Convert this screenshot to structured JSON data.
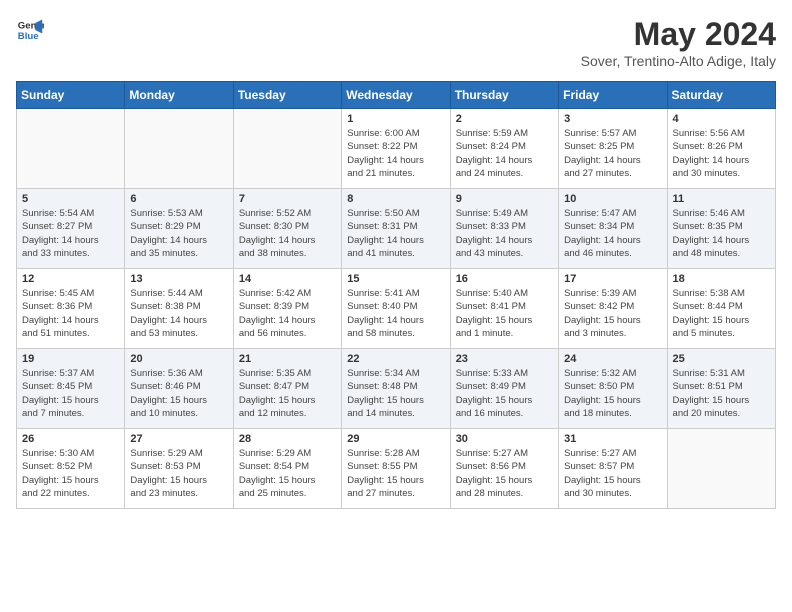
{
  "header": {
    "logo_line1": "General",
    "logo_line2": "Blue",
    "month": "May 2024",
    "location": "Sover, Trentino-Alto Adige, Italy"
  },
  "days_of_week": [
    "Sunday",
    "Monday",
    "Tuesday",
    "Wednesday",
    "Thursday",
    "Friday",
    "Saturday"
  ],
  "weeks": [
    [
      {
        "day": "",
        "info": ""
      },
      {
        "day": "",
        "info": ""
      },
      {
        "day": "",
        "info": ""
      },
      {
        "day": "1",
        "info": "Sunrise: 6:00 AM\nSunset: 8:22 PM\nDaylight: 14 hours\nand 21 minutes."
      },
      {
        "day": "2",
        "info": "Sunrise: 5:59 AM\nSunset: 8:24 PM\nDaylight: 14 hours\nand 24 minutes."
      },
      {
        "day": "3",
        "info": "Sunrise: 5:57 AM\nSunset: 8:25 PM\nDaylight: 14 hours\nand 27 minutes."
      },
      {
        "day": "4",
        "info": "Sunrise: 5:56 AM\nSunset: 8:26 PM\nDaylight: 14 hours\nand 30 minutes."
      }
    ],
    [
      {
        "day": "5",
        "info": "Sunrise: 5:54 AM\nSunset: 8:27 PM\nDaylight: 14 hours\nand 33 minutes."
      },
      {
        "day": "6",
        "info": "Sunrise: 5:53 AM\nSunset: 8:29 PM\nDaylight: 14 hours\nand 35 minutes."
      },
      {
        "day": "7",
        "info": "Sunrise: 5:52 AM\nSunset: 8:30 PM\nDaylight: 14 hours\nand 38 minutes."
      },
      {
        "day": "8",
        "info": "Sunrise: 5:50 AM\nSunset: 8:31 PM\nDaylight: 14 hours\nand 41 minutes."
      },
      {
        "day": "9",
        "info": "Sunrise: 5:49 AM\nSunset: 8:33 PM\nDaylight: 14 hours\nand 43 minutes."
      },
      {
        "day": "10",
        "info": "Sunrise: 5:47 AM\nSunset: 8:34 PM\nDaylight: 14 hours\nand 46 minutes."
      },
      {
        "day": "11",
        "info": "Sunrise: 5:46 AM\nSunset: 8:35 PM\nDaylight: 14 hours\nand 48 minutes."
      }
    ],
    [
      {
        "day": "12",
        "info": "Sunrise: 5:45 AM\nSunset: 8:36 PM\nDaylight: 14 hours\nand 51 minutes."
      },
      {
        "day": "13",
        "info": "Sunrise: 5:44 AM\nSunset: 8:38 PM\nDaylight: 14 hours\nand 53 minutes."
      },
      {
        "day": "14",
        "info": "Sunrise: 5:42 AM\nSunset: 8:39 PM\nDaylight: 14 hours\nand 56 minutes."
      },
      {
        "day": "15",
        "info": "Sunrise: 5:41 AM\nSunset: 8:40 PM\nDaylight: 14 hours\nand 58 minutes."
      },
      {
        "day": "16",
        "info": "Sunrise: 5:40 AM\nSunset: 8:41 PM\nDaylight: 15 hours\nand 1 minute."
      },
      {
        "day": "17",
        "info": "Sunrise: 5:39 AM\nSunset: 8:42 PM\nDaylight: 15 hours\nand 3 minutes."
      },
      {
        "day": "18",
        "info": "Sunrise: 5:38 AM\nSunset: 8:44 PM\nDaylight: 15 hours\nand 5 minutes."
      }
    ],
    [
      {
        "day": "19",
        "info": "Sunrise: 5:37 AM\nSunset: 8:45 PM\nDaylight: 15 hours\nand 7 minutes."
      },
      {
        "day": "20",
        "info": "Sunrise: 5:36 AM\nSunset: 8:46 PM\nDaylight: 15 hours\nand 10 minutes."
      },
      {
        "day": "21",
        "info": "Sunrise: 5:35 AM\nSunset: 8:47 PM\nDaylight: 15 hours\nand 12 minutes."
      },
      {
        "day": "22",
        "info": "Sunrise: 5:34 AM\nSunset: 8:48 PM\nDaylight: 15 hours\nand 14 minutes."
      },
      {
        "day": "23",
        "info": "Sunrise: 5:33 AM\nSunset: 8:49 PM\nDaylight: 15 hours\nand 16 minutes."
      },
      {
        "day": "24",
        "info": "Sunrise: 5:32 AM\nSunset: 8:50 PM\nDaylight: 15 hours\nand 18 minutes."
      },
      {
        "day": "25",
        "info": "Sunrise: 5:31 AM\nSunset: 8:51 PM\nDaylight: 15 hours\nand 20 minutes."
      }
    ],
    [
      {
        "day": "26",
        "info": "Sunrise: 5:30 AM\nSunset: 8:52 PM\nDaylight: 15 hours\nand 22 minutes."
      },
      {
        "day": "27",
        "info": "Sunrise: 5:29 AM\nSunset: 8:53 PM\nDaylight: 15 hours\nand 23 minutes."
      },
      {
        "day": "28",
        "info": "Sunrise: 5:29 AM\nSunset: 8:54 PM\nDaylight: 15 hours\nand 25 minutes."
      },
      {
        "day": "29",
        "info": "Sunrise: 5:28 AM\nSunset: 8:55 PM\nDaylight: 15 hours\nand 27 minutes."
      },
      {
        "day": "30",
        "info": "Sunrise: 5:27 AM\nSunset: 8:56 PM\nDaylight: 15 hours\nand 28 minutes."
      },
      {
        "day": "31",
        "info": "Sunrise: 5:27 AM\nSunset: 8:57 PM\nDaylight: 15 hours\nand 30 minutes."
      },
      {
        "day": "",
        "info": ""
      }
    ]
  ]
}
